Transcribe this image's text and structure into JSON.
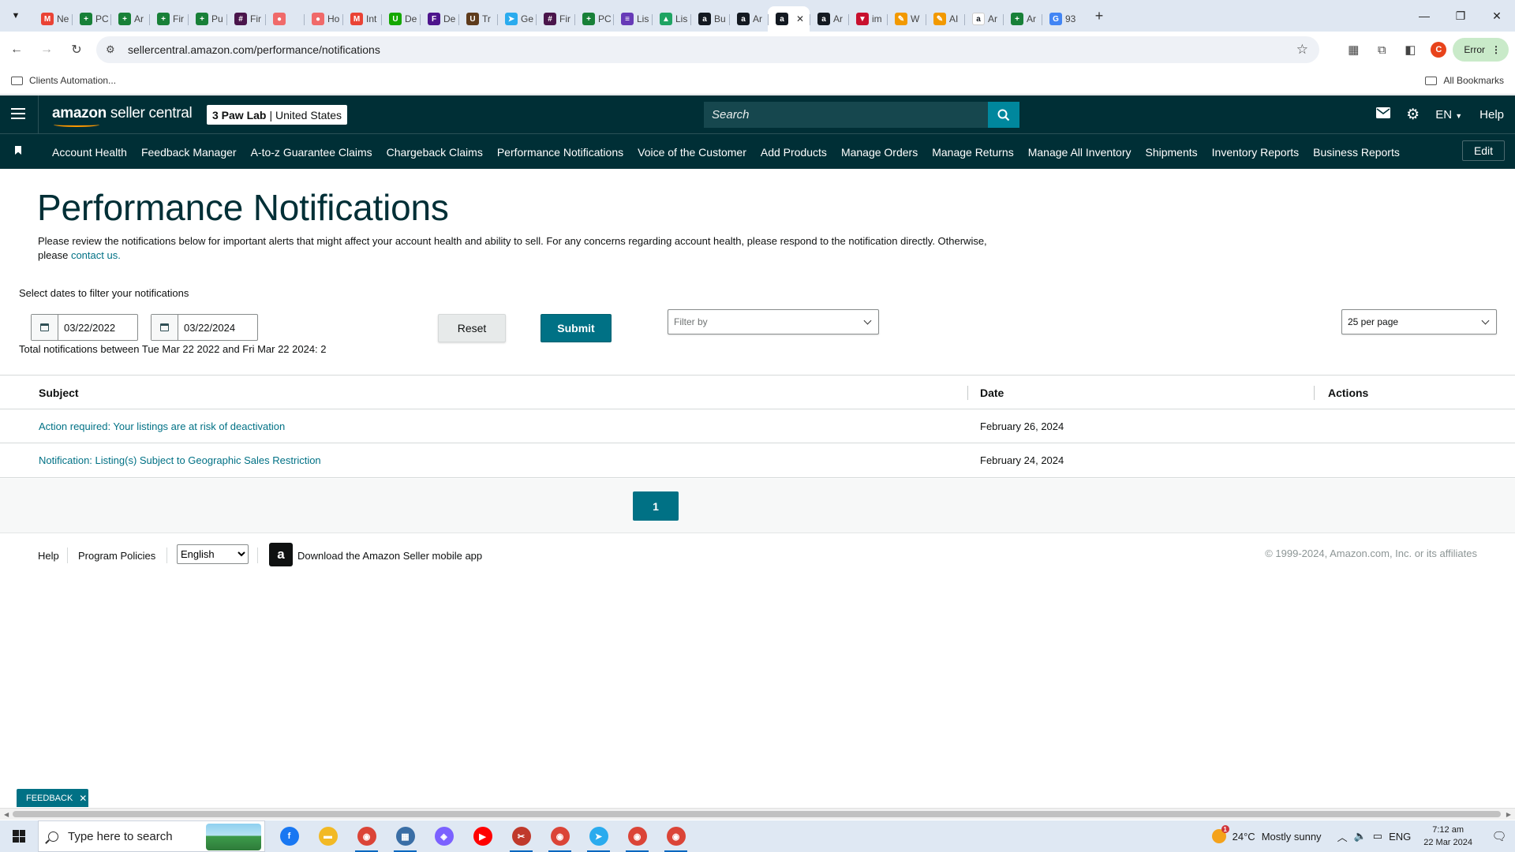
{
  "browser": {
    "tabs": [
      {
        "label": "Ne",
        "icon": "gmail-icon",
        "color": "#ea4335",
        "glyph": "M"
      },
      {
        "label": "PC",
        "icon": "sheets-icon",
        "color": "#188038",
        "glyph": "+"
      },
      {
        "label": "Ar",
        "icon": "sheets-icon",
        "color": "#188038",
        "glyph": "+"
      },
      {
        "label": "Fir",
        "icon": "sheets-icon",
        "color": "#188038",
        "glyph": "+"
      },
      {
        "label": "Pu",
        "icon": "sheets-icon",
        "color": "#188038",
        "glyph": "+"
      },
      {
        "label": "Fir",
        "icon": "slack-icon",
        "color": "#4a154b",
        "glyph": "#"
      },
      {
        "label": "",
        "icon": "asana-icon",
        "color": "#f06a6a",
        "glyph": "●"
      },
      {
        "label": "Ho",
        "icon": "asana-icon",
        "color": "#f06a6a",
        "glyph": "●"
      },
      {
        "label": "Int",
        "icon": "gmail-icon",
        "color": "#ea4335",
        "glyph": "M"
      },
      {
        "label": "De",
        "icon": "upwork-icon",
        "color": "#14a800",
        "glyph": "U"
      },
      {
        "label": "De",
        "icon": "fedex-icon",
        "color": "#4d148c",
        "glyph": "F"
      },
      {
        "label": "Tr",
        "icon": "ups-icon",
        "color": "#5e3b1c",
        "glyph": "U"
      },
      {
        "label": "Ge",
        "icon": "telegram-icon",
        "color": "#2aabee",
        "glyph": "➤"
      },
      {
        "label": "Fir",
        "icon": "slack-icon",
        "color": "#4a154b",
        "glyph": "#"
      },
      {
        "label": "PC",
        "icon": "sheets-icon",
        "color": "#188038",
        "glyph": "+"
      },
      {
        "label": "Lis",
        "icon": "forms-icon",
        "color": "#673ab7",
        "glyph": "≡"
      },
      {
        "label": "Lis",
        "icon": "drive-icon",
        "color": "#1fa463",
        "glyph": "▲"
      },
      {
        "label": "Bu",
        "icon": "amazon-icon",
        "color": "#131921",
        "glyph": "a"
      },
      {
        "label": "Ar",
        "icon": "amazon-icon",
        "color": "#131921",
        "glyph": "a"
      },
      {
        "label": "Ar",
        "icon": "amazon-icon",
        "color": "#131921",
        "glyph": "a"
      },
      {
        "label": "Ar",
        "icon": "amazon-icon",
        "color": "#131921",
        "glyph": "a"
      },
      {
        "label": "im",
        "icon": "vpn-icon",
        "color": "#c8102e",
        "glyph": "▼"
      },
      {
        "label": "W",
        "icon": "pen-icon",
        "color": "#f29900",
        "glyph": "✎"
      },
      {
        "label": "AI",
        "icon": "pen-icon",
        "color": "#f29900",
        "glyph": "✎"
      },
      {
        "label": "Ar",
        "icon": "amazon-icon",
        "color": "#ffffff",
        "glyph": "a"
      },
      {
        "label": "Ar",
        "icon": "sheets-icon",
        "color": "#188038",
        "glyph": "+"
      },
      {
        "label": "93",
        "icon": "google-icon",
        "color": "#4285f4",
        "glyph": "G"
      }
    ],
    "active_tab_index": 19,
    "url": "sellercentral.amazon.com/performance/notifications",
    "profile_initial": "C",
    "error_label": "Error",
    "bookmarks": {
      "folder": "Clients Automation...",
      "all": "All Bookmarks"
    }
  },
  "amazon": {
    "logo_bold": "amazon",
    "logo_rest": " seller central",
    "store_name": "3 Paw Lab",
    "marketplace": "United States",
    "search_placeholder": "Search",
    "lang": "EN",
    "help": "Help",
    "nav": [
      "Account Health",
      "Feedback Manager",
      "A-to-z Guarantee Claims",
      "Chargeback Claims",
      "Performance Notifications",
      "Voice of the Customer",
      "Add Products",
      "Manage Orders",
      "Manage Returns",
      "Manage All Inventory",
      "Shipments",
      "Inventory Reports",
      "Business Reports"
    ],
    "edit": "Edit"
  },
  "page": {
    "title": "Performance Notifications",
    "intro": "Please review the notifications below for important alerts that might affect your account health and ability to sell. For any concerns regarding account health, please respond to the notification directly. Otherwise, please",
    "contact_link": "contact us.",
    "filter_label": "Select dates to filter your notifications",
    "date_from": "03/22/2022",
    "date_to": "03/22/2024",
    "reset": "Reset",
    "submit": "Submit",
    "filter_placeholder": "Filter by",
    "per_page": "25 per page",
    "total_line": "Total notifications between Tue Mar 22 2022 and Fri Mar 22 2024: 2",
    "columns": {
      "subject": "Subject",
      "date": "Date",
      "actions": "Actions"
    },
    "rows": [
      {
        "subject": "Action required: Your listings are at risk of deactivation",
        "date": "February 26, 2024"
      },
      {
        "subject": "Notification: Listing(s) Subject to Geographic Sales Restriction",
        "date": "February 24, 2024"
      }
    ],
    "current_page": "1"
  },
  "footer": {
    "help": "Help",
    "policies": "Program Policies",
    "language": "English",
    "app_text": "Download the Amazon Seller mobile app",
    "copyright": "© 1999-2024, Amazon.com, Inc. or its affiliates"
  },
  "feedback": "FEEDBACK",
  "taskbar": {
    "search_placeholder": "Type here to search",
    "temp": "24°C",
    "weather": "Mostly sunny",
    "lang": "ENG",
    "time": "7:12 am",
    "date": "22 Mar 2024",
    "weather_badge": "1",
    "apps": [
      {
        "name": "facebook-icon",
        "color": "#1877f2",
        "glyph": "f",
        "running": false
      },
      {
        "name": "file-explorer-icon",
        "color": "#f2b924",
        "glyph": "▬",
        "running": false
      },
      {
        "name": "chrome-icon",
        "color": "#db4437",
        "glyph": "◉",
        "running": true
      },
      {
        "name": "calculator-icon",
        "color": "#3a6ea5",
        "glyph": "▦",
        "running": true
      },
      {
        "name": "copilot-icon",
        "color": "#7b61ff",
        "glyph": "◈",
        "running": false
      },
      {
        "name": "youtube-icon",
        "color": "#ff0000",
        "glyph": "▶",
        "running": false
      },
      {
        "name": "snipping-tool-icon",
        "color": "#c0392b",
        "glyph": "✂",
        "running": true
      },
      {
        "name": "chrome-profile-icon",
        "color": "#db4437",
        "glyph": "◉",
        "running": true
      },
      {
        "name": "telegram-icon",
        "color": "#2aabee",
        "glyph": "➤",
        "running": true
      },
      {
        "name": "chrome-profile-icon",
        "color": "#db4437",
        "glyph": "◉",
        "running": true
      },
      {
        "name": "chrome-profile-icon",
        "color": "#db4437",
        "glyph": "◉",
        "running": true
      }
    ]
  }
}
